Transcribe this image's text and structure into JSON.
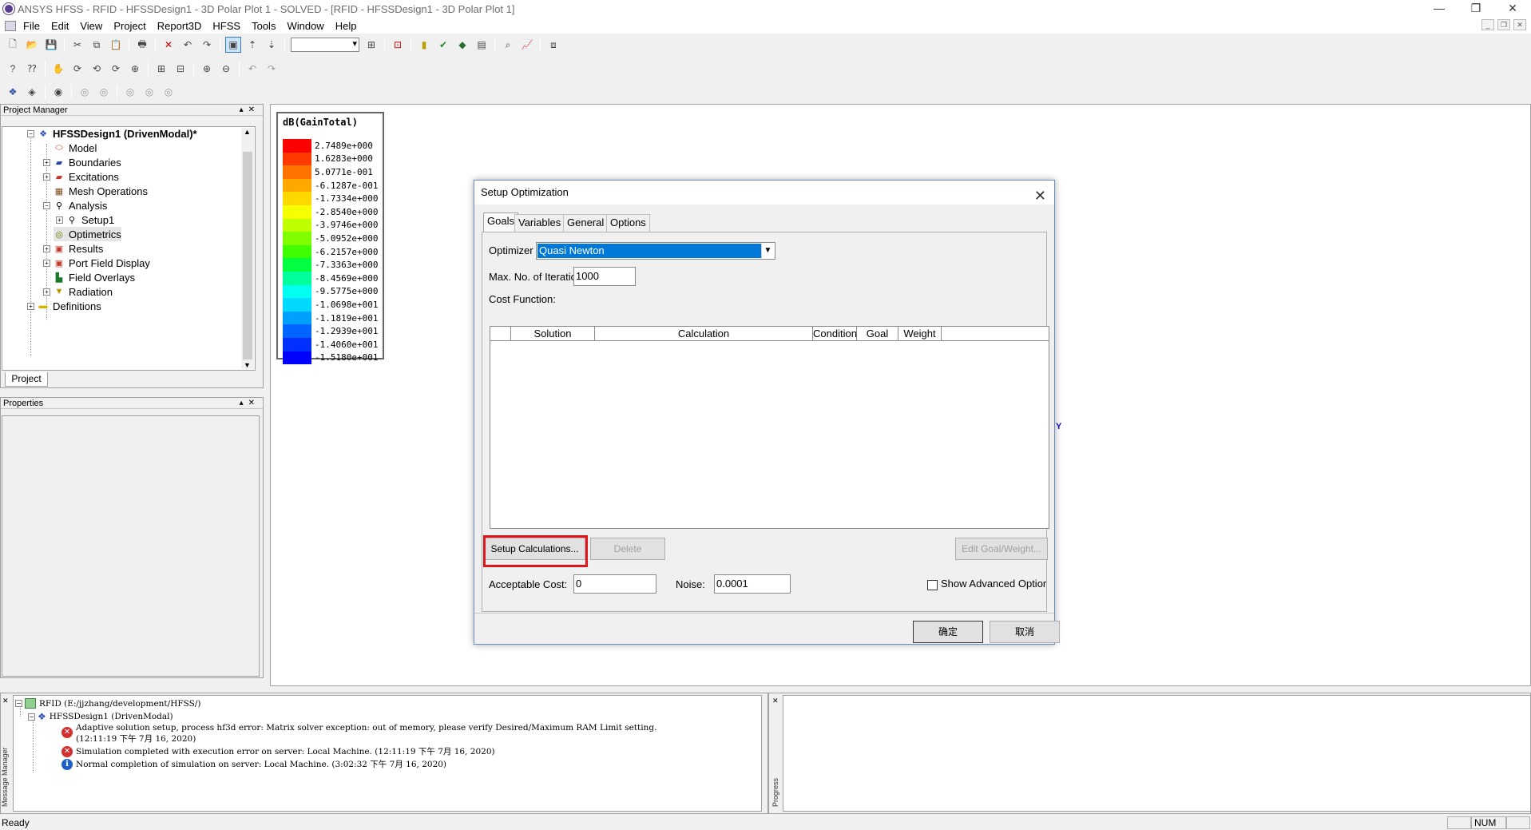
{
  "window": {
    "title": "ANSYS HFSS - RFID - HFSSDesign1 - 3D Polar Plot 1 - SOLVED - [RFID - HFSSDesign1 - 3D Polar Plot 1]"
  },
  "menu": [
    "File",
    "Edit",
    "View",
    "Project",
    "Report3D",
    "HFSS",
    "Tools",
    "Window",
    "Help"
  ],
  "project_manager": {
    "title": "Project Manager",
    "tab": "Project",
    "tree": [
      {
        "label": "HFSSDesign1 (DrivenModal)*",
        "icon": "hfss-design-icon",
        "bold": true
      },
      {
        "label": "Model",
        "icon": "model-icon"
      },
      {
        "label": "Boundaries",
        "icon": "boundaries-icon"
      },
      {
        "label": "Excitations",
        "icon": "excitations-icon"
      },
      {
        "label": "Mesh Operations",
        "icon": "mesh-icon"
      },
      {
        "label": "Analysis",
        "icon": "analysis-icon"
      },
      {
        "label": "Setup1",
        "icon": "setup-icon"
      },
      {
        "label": "Optimetrics",
        "icon": "optimetrics-icon"
      },
      {
        "label": "Results",
        "icon": "results-icon"
      },
      {
        "label": "Port Field Display",
        "icon": "port-field-icon"
      },
      {
        "label": "Field Overlays",
        "icon": "field-overlays-icon"
      },
      {
        "label": "Radiation",
        "icon": "radiation-icon"
      },
      {
        "label": "Definitions",
        "icon": "folder-icon"
      }
    ]
  },
  "properties": {
    "title": "Properties"
  },
  "legend": {
    "title": "dB(GainTotal)",
    "values": [
      "2.7489e+000",
      "1.6283e+000",
      "5.0771e-001",
      "-6.1287e-001",
      "-1.7334e+000",
      "-2.8540e+000",
      "-3.9746e+000",
      "-5.0952e+000",
      "-6.2157e+000",
      "-7.3363e+000",
      "-8.4569e+000",
      "-9.5775e+000",
      "-1.0698e+001",
      "-1.1819e+001",
      "-1.2939e+001",
      "-1.4060e+001",
      "-1.5180e+001"
    ],
    "colors": [
      "#ff0000",
      "#ff3a00",
      "#ff7400",
      "#ffa800",
      "#ffd800",
      "#f5ff00",
      "#bfff00",
      "#7fff00",
      "#3fff00",
      "#00ff40",
      "#00ff9a",
      "#00fff0",
      "#00d8ff",
      "#00a0ff",
      "#0064ff",
      "#0030ff",
      "#0000ff"
    ]
  },
  "axis_label": "Y",
  "dialog": {
    "title": "Setup Optimization",
    "tabs": [
      "Goals",
      "Variables",
      "General",
      "Options"
    ],
    "optimizer_label": "Optimizer",
    "optimizer_value": "Quasi Newton",
    "max_iter_label": "Max. No. of Iterations:",
    "max_iter_value": "1000",
    "cost_function_label": "Cost Function:",
    "table_headers": [
      "",
      "Solution",
      "Calculation",
      "Condition",
      "Goal",
      "Weight"
    ],
    "setup_calc_btn": "Setup Calculations...",
    "delete_btn": "Delete",
    "edit_goal_btn": "Edit Goal/Weight...",
    "acceptable_cost_label": "Acceptable Cost:",
    "acceptable_cost_value": "0",
    "noise_label": "Noise:",
    "noise_value": "0.0001",
    "show_advanced_label": "Show Advanced Optior",
    "ok_btn": "确定",
    "cancel_btn": "取消"
  },
  "messages": {
    "panel_label": "Message Manager",
    "project": "RFID (E:/jjzhang/development/HFSS/)",
    "design": "HFSSDesign1 (DrivenModal)",
    "items": [
      {
        "type": "error",
        "line1": "Adaptive solution setup, process hf3d error: Matrix solver exception: out of memory, please verify Desired/Maximum RAM Limit setting.",
        "line2": "(12:11:19 下午  7月 16, 2020)"
      },
      {
        "type": "error",
        "line1": "Simulation completed with execution error on server: Local Machine. (12:11:19 下午  7月 16, 2020)",
        "line2": ""
      },
      {
        "type": "info",
        "line1": "Normal completion of simulation on server: Local Machine. (3:02:32 下午  7月 16, 2020)",
        "line2": ""
      }
    ]
  },
  "progress": {
    "panel_label": "Progress"
  },
  "status": {
    "text": "Ready",
    "num": "NUM"
  }
}
